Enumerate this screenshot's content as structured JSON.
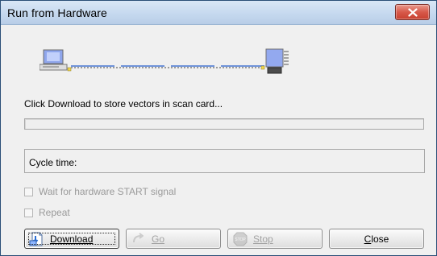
{
  "window": {
    "title": "Run from Hardware"
  },
  "status": {
    "message": "Click Download to store vectors in scan card..."
  },
  "progress": {
    "value_percent": 0,
    "fill_color": "#55b84b"
  },
  "cycle": {
    "label": "Cycle time:"
  },
  "options": [
    {
      "label": "Wait for hardware START signal",
      "checked": false,
      "enabled": false
    },
    {
      "label": "Repeat",
      "checked": false,
      "enabled": false
    }
  ],
  "buttons": {
    "download": {
      "label": "Download",
      "icon": "download-icon",
      "enabled": true,
      "focused": true
    },
    "go": {
      "label": "Go",
      "icon": "go-arrow-icon",
      "enabled": false
    },
    "stop": {
      "label": "Stop",
      "icon": "stop-sign-icon",
      "enabled": false
    },
    "close": {
      "label": "Close",
      "enabled": true
    }
  },
  "colors": {
    "titlebar": "#c6d9ef",
    "close_button": "#d8594a",
    "link_line": "#6f93d9",
    "disabled_text": "#9a9a9a"
  }
}
